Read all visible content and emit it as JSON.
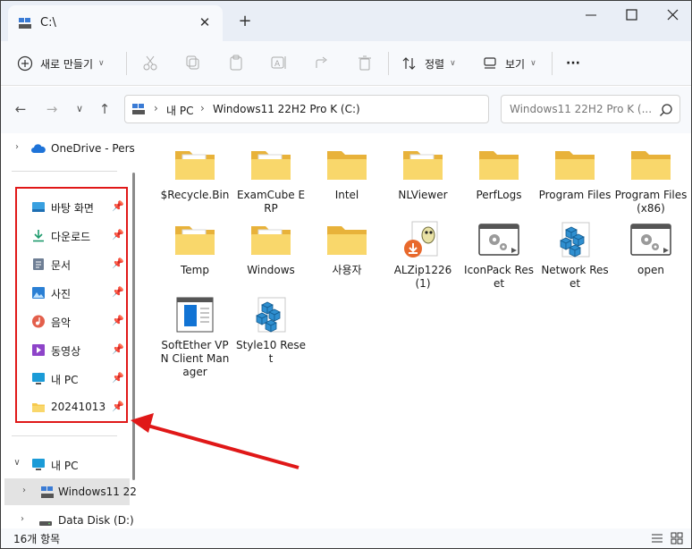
{
  "tab": {
    "title": "C:\\",
    "close": "✕",
    "new": "+"
  },
  "cmdbar": {
    "new_label": "새로 만들기",
    "sort_label": "정렬",
    "view_label": "보기",
    "more": "···"
  },
  "address": {
    "crumbs": [
      "내 PC",
      "Windows11 22H2 Pro K (C:)"
    ],
    "search_placeholder": "Windows11 22H2 Pro K (..."
  },
  "sidebar": {
    "onedrive": "OneDrive - Pers",
    "quick": [
      {
        "label": "바탕 화면",
        "icon": "desktop-icon"
      },
      {
        "label": "다운로드",
        "icon": "download-icon"
      },
      {
        "label": "문서",
        "icon": "documents-icon"
      },
      {
        "label": "사진",
        "icon": "pictures-icon"
      },
      {
        "label": "음악",
        "icon": "music-icon"
      },
      {
        "label": "동영상",
        "icon": "videos-icon"
      },
      {
        "label": "내 PC",
        "icon": "computer-icon"
      },
      {
        "label": "20241013",
        "icon": "folder-icon"
      }
    ],
    "this_pc": "내 PC",
    "drive_c": "Windows11 22",
    "drive_d": "Data Disk (D:)"
  },
  "items": [
    {
      "name": "$Recycle.Bin",
      "type": "folder-doc"
    },
    {
      "name": "ExamCube ERP",
      "type": "folder-doc"
    },
    {
      "name": "Intel",
      "type": "folder"
    },
    {
      "name": "NLViewer",
      "type": "folder-doc"
    },
    {
      "name": "PerfLogs",
      "type": "folder"
    },
    {
      "name": "Program Files",
      "type": "folder"
    },
    {
      "name": "Program Files (x86)",
      "type": "folder"
    },
    {
      "name": "Temp",
      "type": "folder-doc"
    },
    {
      "name": "Windows",
      "type": "folder-doc"
    },
    {
      "name": "사용자",
      "type": "folder"
    },
    {
      "name": "ALZip1226 (1)",
      "type": "alzip"
    },
    {
      "name": "IconPack Reset",
      "type": "gear-app"
    },
    {
      "name": "Network Reset",
      "type": "cube-app"
    },
    {
      "name": "open",
      "type": "gear-app"
    },
    {
      "name": "SoftEther VPN Client Manager",
      "type": "vpn-app"
    },
    {
      "name": "Style10 Reset",
      "type": "cube-app"
    }
  ],
  "status": {
    "count": "16개 항목"
  },
  "colors": {
    "annotation": "#e01818",
    "folder": "#f6c94d",
    "accent": "#0067c0"
  }
}
